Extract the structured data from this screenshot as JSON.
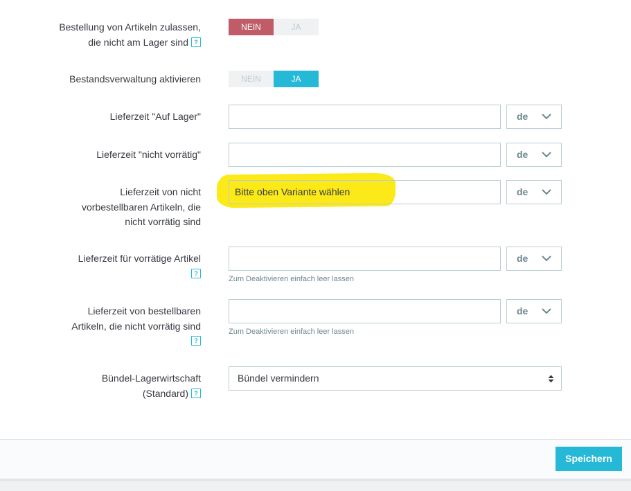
{
  "rows": {
    "allow_orders": {
      "label_line1": "Bestellung von Artikeln zulassen,",
      "label_line2": "die nicht am Lager sind",
      "no": "NEIN",
      "yes": "JA",
      "selected": "NEIN"
    },
    "stock_management": {
      "label": "Bestandsverwaltung aktivieren",
      "no": "NEIN",
      "yes": "JA",
      "selected": "JA"
    },
    "in_stock_delivery": {
      "label": "Lieferzeit \"Auf Lager\"",
      "value": "",
      "lang": "de"
    },
    "out_of_stock_delivery": {
      "label": "Lieferzeit \"nicht vorrätig\"",
      "value": "",
      "lang": "de"
    },
    "not_orderable_delivery": {
      "label_line1": "Lieferzeit von nicht",
      "label_line2": "vorbestellbaren Artikeln, die",
      "label_line3": "nicht vorrätig sind",
      "value": "Bitte oben Variante wählen",
      "lang": "de"
    },
    "in_stock_products": {
      "label": "Lieferzeit für vorrätige Artikel",
      "value": "",
      "lang": "de",
      "hint": "Zum Deaktivieren einfach leer lassen"
    },
    "orderable_products": {
      "label_line1": "Lieferzeit von bestellbaren",
      "label_line2": "Artikeln, die nicht vorrätig sind",
      "value": "",
      "lang": "de",
      "hint": "Zum Deaktivieren einfach leer lassen"
    },
    "pack_stock": {
      "label_line1": "Bündel-Lagerwirtschaft",
      "label_line2": "(Standard)",
      "value": "Bündel vermindern"
    }
  },
  "help_icon_text": "?",
  "footer": {
    "save_label": "Speichern"
  },
  "colors": {
    "accent": "#25b9d7",
    "no_active": "#c05c67",
    "toggle_inactive": "#eff1f2",
    "highlight": "#fbe80c"
  }
}
